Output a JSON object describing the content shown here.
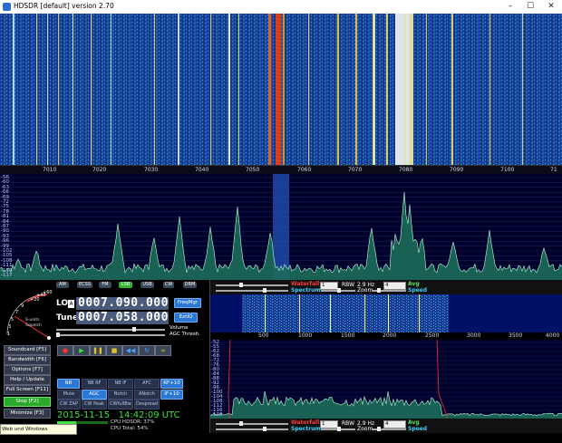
{
  "window": {
    "title": "HDSDR [default]  version 2.70",
    "controls": {
      "minimize": "–",
      "maximize": "☐",
      "close": "✕"
    }
  },
  "rf_scale": {
    "ticks": [
      "7010",
      "7020",
      "7030",
      "7040",
      "7050",
      "7060",
      "7070",
      "7080",
      "7090",
      "7100",
      "71"
    ]
  },
  "spectrum": {
    "db_labels": [
      "-56",
      "-60",
      "-63",
      "-66",
      "-69",
      "-72",
      "-75",
      "-78",
      "-81",
      "-84",
      "-87",
      "-90",
      "-93",
      "-96",
      "-99",
      "-102",
      "-105",
      "-108",
      "-111",
      "-114",
      "-117"
    ]
  },
  "modes": {
    "buttons": [
      "AM",
      "ECSS",
      "FM",
      "LSB",
      "USB",
      "CW",
      "DRM"
    ],
    "active": "LSB"
  },
  "smeter": {
    "scale_labels": [
      "+20",
      "+40",
      "+60",
      "9",
      "7",
      "5",
      "3",
      "1"
    ],
    "unit": "S-units",
    "sub": "Squelch"
  },
  "lo": {
    "label": "LO",
    "marker": "A",
    "value": "0007.090.000"
  },
  "tune": {
    "label": "Tune",
    "value": "0007.058.000"
  },
  "freq_buttons": {
    "freqmgr": "FreqMgr",
    "extio": "ExtIO"
  },
  "volume": {
    "volume_label": "Volume",
    "agc_label": "AGC Thresh."
  },
  "side_buttons": [
    "Soundcard  [F5]",
    "Bandwidth  [F6]",
    "Options  [F7]",
    "Help / Update  [F1]",
    "Full Screen  [F11]",
    "Stop  [F2]",
    "Minimize  [F3]"
  ],
  "playback_icons": [
    "record-icon",
    "play-icon",
    "pause-icon",
    "stop-icon",
    "rewind-icon",
    "loop-icon"
  ],
  "dsp_buttons": {
    "row1": [
      "NR",
      "NB RF",
      "NB IF",
      "AFC"
    ],
    "row2": [
      "Mute",
      "AGC Slow",
      "Notch",
      "ANotch"
    ],
    "row3": [
      "CW ZAP",
      "CW Peak",
      "CWfullBw",
      "Despread"
    ],
    "rf": "RF+10",
    "if": "IF+10"
  },
  "datetime": "2015-11-15   14:42:09 UTC",
  "cpu": {
    "hdsdr": "CPU HDSDR:  37%",
    "total": "CPU Total:  54%"
  },
  "tooltip": "Web und Windows durchsuchen",
  "top_bar": {
    "waterfall": "Waterfall",
    "spectrum": "Spectrum",
    "rbw_label": "RBW",
    "rbw_value": "2.9 Hz",
    "avg": "Avg",
    "speed": "Speed",
    "zoom": "Zoom",
    "box1": "1",
    "box2": "4"
  },
  "af_scale": {
    "ticks": [
      "500",
      "1000",
      "1500",
      "2000",
      "2500",
      "3000",
      "3500",
      "4000"
    ]
  },
  "af_db_labels": [
    "-52",
    "-55",
    "-62",
    "-68",
    "-72",
    "-76",
    "-80",
    "-84",
    "-88",
    "-92",
    "-96",
    "-100",
    "-104",
    "-108",
    "-112",
    "-116",
    "-120"
  ],
  "bottom_bar": {
    "waterfall": "Waterfall",
    "spectrum": "Spectrum",
    "rbw_label": "RBW",
    "rbw_value": "2.9 Hz",
    "avg": "Avg",
    "speed": "Speed",
    "zoom": "Zoom",
    "box1": "1",
    "box2": "4"
  },
  "colors": {
    "accent_blue": "#2a77d4",
    "mode_active": "#31b531",
    "waterfall_label": "#ff3a3a",
    "spectrum_label": "#39d1ff",
    "avg_label": "#5fe05f"
  }
}
